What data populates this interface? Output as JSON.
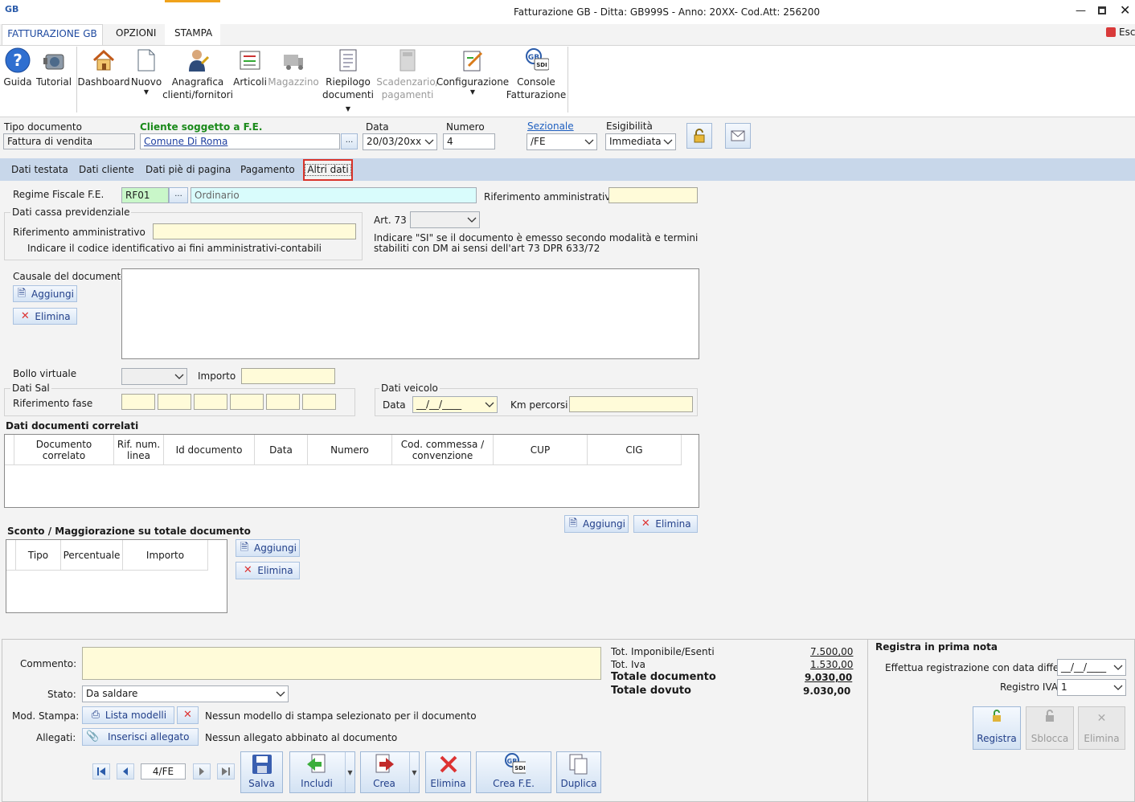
{
  "window": {
    "title": "Fatturazione GB - Ditta: GB999S - Anno: 20XX- Cod.Att: 256200",
    "app_logo": "GB",
    "exit_label": "Esci"
  },
  "menu_tabs": [
    "FATTURAZIONE GB",
    "OPZIONI",
    "STAMPA"
  ],
  "ribbon": {
    "guida": "Guida",
    "tutorial": "Tutorial",
    "dashboard": "Dashboard",
    "nuovo": "Nuovo",
    "anagrafica_1": "Anagrafica",
    "anagrafica_2": "clienti/fornitori",
    "articoli": "Articoli",
    "magazzino": "Magazzino",
    "riepilogo_1": "Riepilogo",
    "riepilogo_2": "documenti",
    "scadenzario_1": "Scadenzario/",
    "scadenzario_2": "pagamenti",
    "configurazione": "Configurazione",
    "console_1": "Console",
    "console_2": "Fatturazione",
    "sdi": "SDI"
  },
  "header": {
    "tipo_documento_label": "Tipo documento",
    "tipo_documento_value": "Fattura di vendita",
    "cliente_label": "Cliente soggetto a F.E.",
    "cliente_value": "Comune Di Roma",
    "data_label": "Data",
    "data_value": "20/03/20xx",
    "numero_label": "Numero",
    "numero_value": "4",
    "sezionale_label": "Sezionale",
    "sezionale_value": "/FE",
    "esigibilita_label": "Esigibilità",
    "esigibilita_value": "Immediata",
    "ellipsis": "..."
  },
  "tabs": [
    "Dati testata",
    "Dati cliente",
    "Dati piè di pagina",
    "Pagamento",
    "Altri dati"
  ],
  "altri_dati": {
    "regime_label": "Regime Fiscale F.E.",
    "regime_code": "RF01",
    "regime_desc": "Ordinario",
    "rif_amm_label": "Riferimento amministrativo",
    "cassa_title": "Dati cassa previdenziale",
    "cassa_rif_label": "Riferimento amministrativo",
    "cassa_hint": "Indicare il codice identificativo ai fini amministrativi-contabili",
    "art73_label": "Art. 73",
    "art73_hint_1": "Indicare \"SI\" se il documento è emesso secondo modalità e termini",
    "art73_hint_2": "stabiliti con DM ai sensi dell'art 73 DPR 633/72",
    "causale_label": "Causale del documento",
    "aggiungi": "Aggiungi",
    "elimina": "Elimina",
    "bollo_label": "Bollo virtuale",
    "importo_label": "Importo",
    "sal_title": "Dati Sal",
    "rif_fase_label": "Riferimento fase",
    "veicolo_title": "Dati veicolo",
    "veicolo_data_label": "Data",
    "veicolo_data_value": "__/__/____",
    "km_label": "Km percorsi",
    "correlati_title": "Dati documenti correlati",
    "correlati_columns": [
      "Documento correlato",
      "Rif. num. linea",
      "Id documento",
      "Data",
      "Numero",
      "Cod. commessa / convenzione",
      "CUP",
      "CIG"
    ],
    "sconto_title": "Sconto / Maggiorazione su totale documento",
    "sconto_columns": [
      "Tipo",
      "Percentuale",
      "Importo"
    ]
  },
  "footer": {
    "commento_label": "Commento:",
    "stato_label": "Stato:",
    "stato_value": "Da saldare",
    "mod_stampa_label": "Mod. Stampa:",
    "lista_modelli": "Lista modelli",
    "mod_stampa_msg": "Nessun modello di stampa selezionato per il documento",
    "allegati_label": "Allegati:",
    "inserisci_allegato": "Inserisci allegato",
    "allegati_msg": "Nessun allegato abbinato al documento",
    "nav_value": "4/FE",
    "buttons": {
      "salva": "Salva",
      "includi": "Includi",
      "crea": "Crea",
      "elimina": "Elimina",
      "crea_fe": "Crea F.E.",
      "duplica": "Duplica"
    },
    "totals": {
      "imponibile_label": "Tot. Imponibile/Esenti",
      "imponibile_value": "7.500,00",
      "iva_label": "Tot. Iva",
      "iva_value": "1.530,00",
      "documento_label": "Totale documento",
      "documento_value": "9.030,00",
      "dovuto_label": "Totale dovuto",
      "dovuto_value": "9.030,00"
    },
    "registra": {
      "title": "Registra in prima nota",
      "differita_label": "Effettua registrazione con data differita:",
      "differita_value": "__/__/____",
      "registro_label": "Registro IVA:",
      "registro_value": "1",
      "registra_btn": "Registra",
      "sblocca_btn": "Sblocca",
      "elimina_btn": "Elimina"
    }
  }
}
